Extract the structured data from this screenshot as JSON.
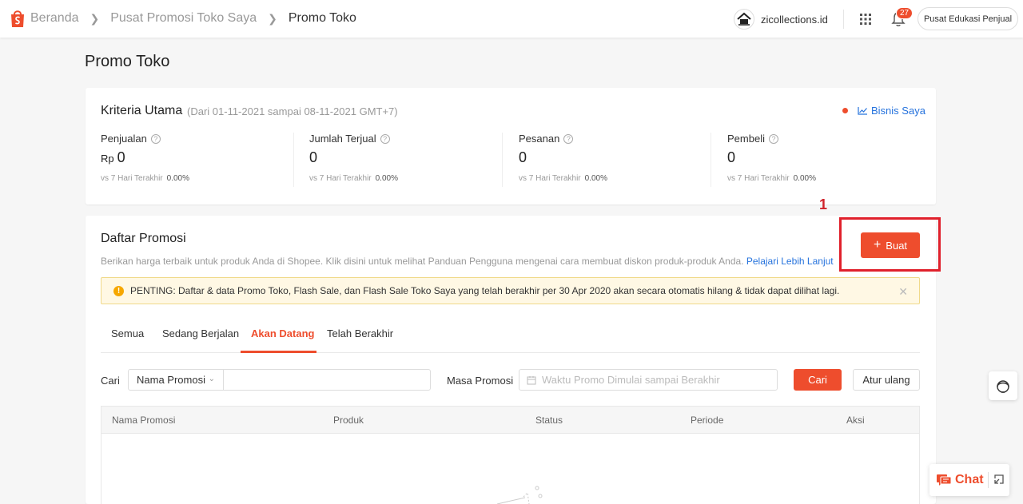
{
  "breadcrumb": [
    "Beranda",
    "Pusat Promosi Toko Saya",
    "Promo Toko"
  ],
  "header": {
    "shop_name": "zicollections.id",
    "notification_count": "27",
    "edu_label": "Pusat Edukasi Penjual"
  },
  "page_title": "Promo Toko",
  "kriteria": {
    "title": "Kriteria Utama",
    "range": "(Dari 01-11-2021 sampai 08-11-2021 GMT+7)",
    "bisnis_link": "Bisnis Saya",
    "metrics": [
      {
        "label": "Penjualan",
        "currency": "Rp",
        "value": "0",
        "compare_label": "vs 7 Hari Terakhir",
        "compare_value": "0.00%"
      },
      {
        "label": "Jumlah Terjual",
        "currency": "",
        "value": "0",
        "compare_label": "vs 7 Hari Terakhir",
        "compare_value": "0.00%"
      },
      {
        "label": "Pesanan",
        "currency": "",
        "value": "0",
        "compare_label": "vs 7 Hari Terakhir",
        "compare_value": "0.00%"
      },
      {
        "label": "Pembeli",
        "currency": "",
        "value": "0",
        "compare_label": "vs 7 Hari Terakhir",
        "compare_value": "0.00%"
      }
    ]
  },
  "annotation_number": "1",
  "daftar": {
    "title": "Daftar Promosi",
    "create_label": "Buat",
    "description": "Berikan harga terbaik untuk produk Anda di Shopee. Klik disini untuk melihat Panduan Pengguna mengenai cara membuat diskon produk-produk Anda.",
    "learn_more": "Pelajari Lebih Lanjut",
    "alert": "PENTING: Daftar & data Promo Toko, Flash Sale, dan Flash Sale Toko Saya yang telah berakhir per 30 Apr 2020 akan secara otomatis hilang & tidak dapat dilihat lagi.",
    "tabs": [
      "Semua",
      "Sedang Berjalan",
      "Akan Datang",
      "Telah Berakhir"
    ],
    "active_tab": "Akan Datang"
  },
  "filters": {
    "search_label": "Cari",
    "search_field_select": "Nama Promosi",
    "search_value": "",
    "period_label": "Masa Promosi",
    "period_placeholder": "Waktu Promo Dimulai sampai Berakhir",
    "search_button": "Cari",
    "reset_button": "Atur ulang"
  },
  "table": {
    "columns": [
      "Nama Promosi",
      "Produk",
      "Status",
      "Periode",
      "Aksi"
    ],
    "rows": []
  },
  "chat": {
    "label": "Chat"
  },
  "colors": {
    "accent": "#ee4d2d",
    "link": "#2673dd",
    "annotation": "#e0202b"
  }
}
